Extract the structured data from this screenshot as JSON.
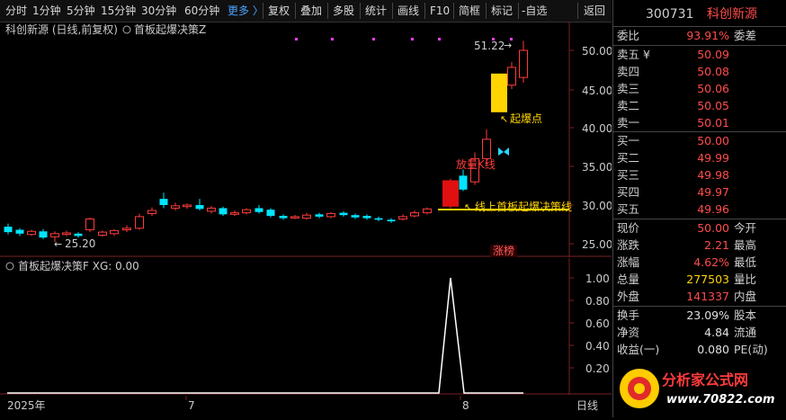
{
  "toolbar": {
    "periods": [
      "分时",
      "1分钟",
      "5分钟",
      "15分钟",
      "30分钟",
      "60分钟"
    ],
    "more": "更多 〉",
    "buttons": [
      "复权",
      "叠加",
      "多股",
      "统计",
      "画线",
      "F10",
      "简框",
      "标记",
      "-自选",
      "返回"
    ]
  },
  "main_chart": {
    "title": "科创新源 (日线,前复权)",
    "formula": "首板起爆决策Z",
    "annotations": {
      "high_label": "51.22",
      "low_label": "25.20",
      "qibao": "起爆点",
      "fangliang": "放量K线",
      "shoupan": "线上首板起爆决策线",
      "zhangbang": "涨榜"
    },
    "y_ticks": [
      "50.00",
      "45.00",
      "40.00",
      "35.00",
      "30.00",
      "25.00"
    ]
  },
  "sub_chart": {
    "title": "首板起爆决策F  XG: 0.00",
    "y_ticks": [
      "1.00",
      "0.80",
      "0.60",
      "0.40",
      "0.20"
    ]
  },
  "time_axis": {
    "labels": [
      "2025年",
      "7",
      "8"
    ],
    "right_label": "日线"
  },
  "quote": {
    "code": "300731",
    "name": "科创新源",
    "weibi_label": "委比",
    "weibi": "93.91%",
    "weicha_label": "委差",
    "asks": [
      {
        "label": "卖五 ¥",
        "price": "50.09"
      },
      {
        "label": "卖四",
        "price": "50.08"
      },
      {
        "label": "卖三",
        "price": "50.06"
      },
      {
        "label": "卖二",
        "price": "50.05"
      },
      {
        "label": "卖一",
        "price": "50.01"
      }
    ],
    "bids": [
      {
        "label": "买一",
        "price": "50.00"
      },
      {
        "label": "买二",
        "price": "49.99"
      },
      {
        "label": "买三",
        "price": "49.98"
      },
      {
        "label": "买四",
        "price": "49.97"
      },
      {
        "label": "买五",
        "price": "49.96"
      }
    ],
    "stats": [
      {
        "l1": "现价",
        "v1": "50.00",
        "c1": "red",
        "l2": "今开"
      },
      {
        "l1": "涨跌",
        "v1": "2.21",
        "c1": "red",
        "l2": "最高"
      },
      {
        "l1": "涨幅",
        "v1": "4.62%",
        "c1": "red",
        "l2": "最低"
      },
      {
        "l1": "总量",
        "v1": "277503",
        "c1": "yellow",
        "l2": "量比"
      },
      {
        "l1": "外盘",
        "v1": "141337",
        "c1": "red",
        "l2": "内盘"
      }
    ],
    "stats2": [
      {
        "l1": "换手",
        "v1": "23.09%",
        "l2": "股本"
      },
      {
        "l1": "净资",
        "v1": "4.84",
        "l2": "流通"
      },
      {
        "l1": "收益(一)",
        "v1": "0.080",
        "l2": "PE(动)"
      }
    ]
  },
  "watermark": {
    "text1": "分析家公式网",
    "text2": "www.70822.com"
  },
  "colors": {
    "up": "#ff3b3b",
    "down": "#00e5ff",
    "signal": "#ffd400",
    "bg": "#000000"
  }
}
